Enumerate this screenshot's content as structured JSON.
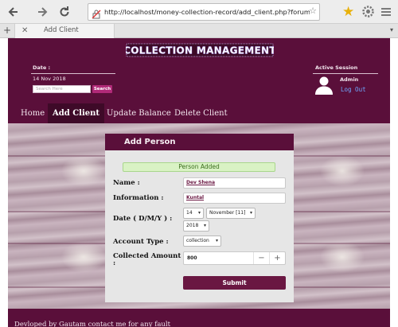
{
  "browser": {
    "url": "http://localhost/money-collection-record/add_client.php?forum_condition=1&",
    "tab_title": "Add Client",
    "icons": {
      "back": "arrow-left-icon",
      "forward": "arrow-right-icon",
      "reload": "reload-icon",
      "insecure": "insecure-lock-icon",
      "bookmark": "star-icon",
      "settings": "gear-icon",
      "menu": "hamburger-menu-icon"
    }
  },
  "header": {
    "logo_text": "COLLECTION MANAGEMENT",
    "date_label": "Date :",
    "date_value": "14 Nov 2018",
    "search_placeholder": "Search Here",
    "search_button": "Search",
    "session_label": "Active Session",
    "admin_name": "Admin",
    "logout": "Log Out"
  },
  "nav": {
    "items": [
      {
        "label": "Home",
        "active": false
      },
      {
        "label": "Add Client",
        "active": true
      },
      {
        "label": "Update Balance",
        "active": false
      },
      {
        "label": "Delete Client",
        "active": false
      }
    ]
  },
  "form": {
    "title": "Add Person",
    "alert": "Person Added",
    "name_label": "Name :",
    "name_value": "Dev Shena",
    "info_label": "Information :",
    "info_value": "Kuntal",
    "date_label": "Date ( D/M/Y ) :",
    "day": "14",
    "month": "November [11]",
    "year": "2018",
    "account_type_label": "Account Type :",
    "account_type": "collection",
    "amount_label": "Collected Amount",
    "amount_label_suffix": ":",
    "amount_value": "800",
    "minus": "−",
    "plus": "+",
    "submit": "Submit"
  },
  "footer": {
    "text": "Devloped by Gautam contact me for any fault"
  },
  "colors": {
    "brand": "#5a0f3a",
    "nav_active": "#3e0a28",
    "submit": "#6a1742",
    "link": "#6fa8ff",
    "alert_bg": "#d9f2c4"
  }
}
